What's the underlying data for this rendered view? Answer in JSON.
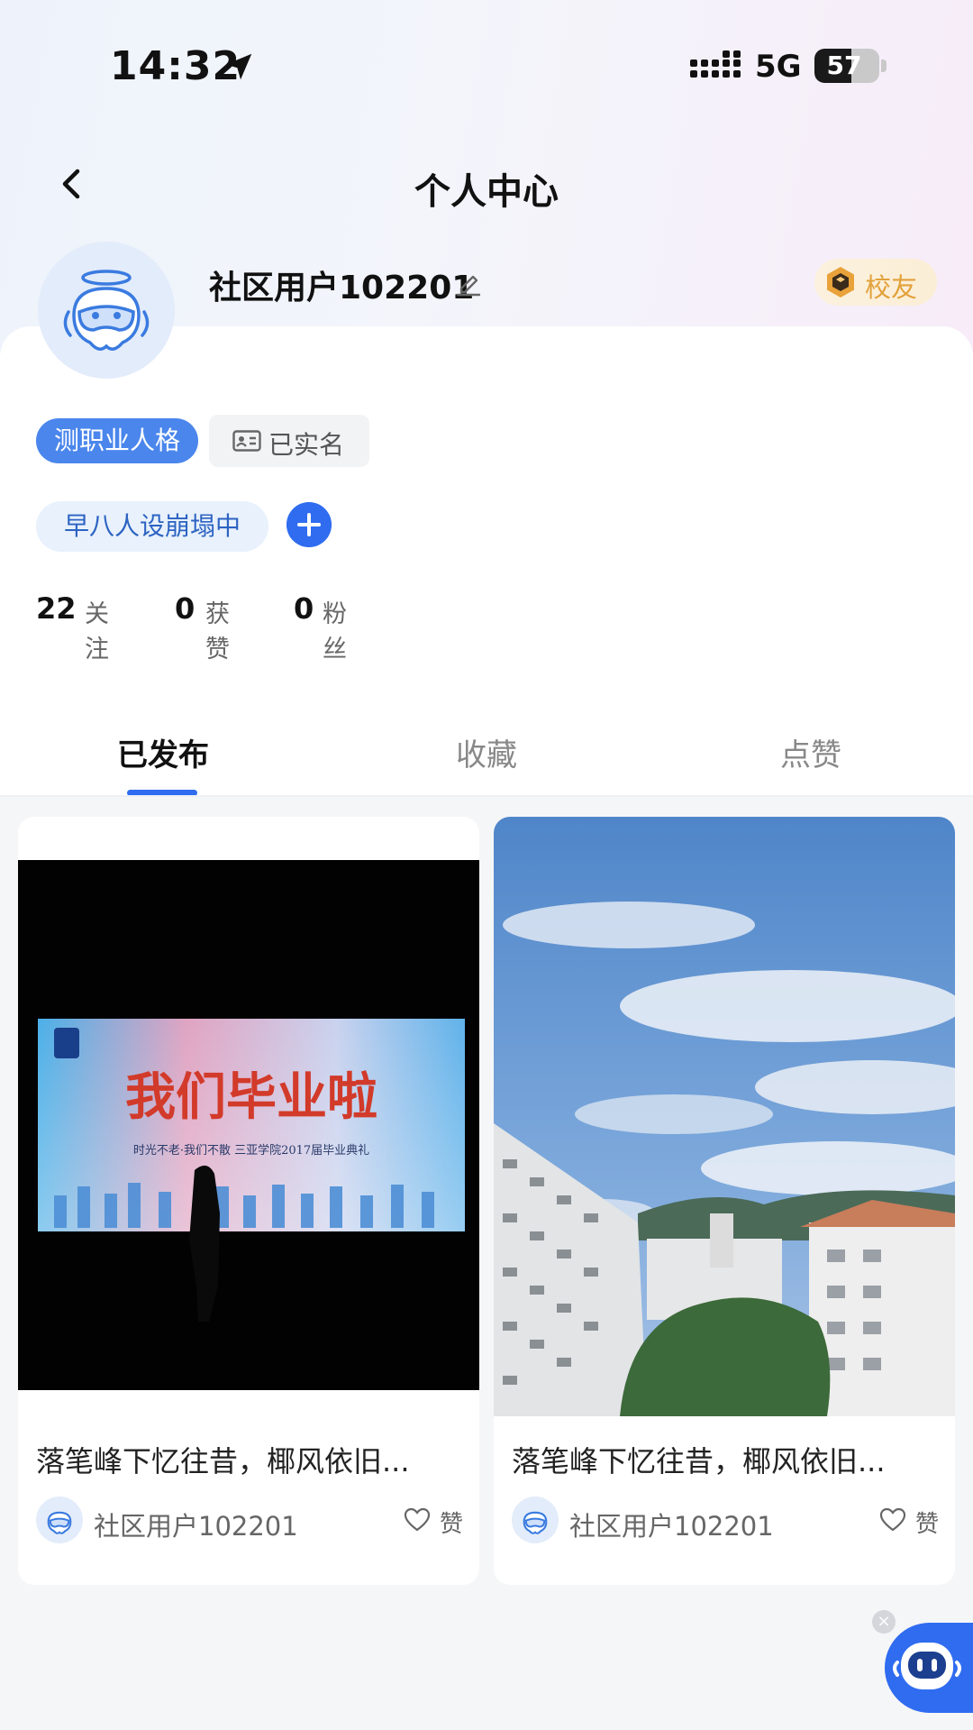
{
  "status_bar": {
    "time": "14:32",
    "network": "5G",
    "battery_level": "57",
    "battery_fraction": 0.57
  },
  "nav": {
    "back_icon": "chevron-left-icon",
    "title": "个人中心"
  },
  "profile": {
    "username": "社区用户102201",
    "edit_icon": "pencil-icon",
    "badge_label": "校友",
    "badge_icon": "alumni-hexagon-icon",
    "personality_tag": "测职业人格",
    "verified_label": "已实名",
    "status_tag": "早八人设崩塌中",
    "add_tag_icon": "plus-icon"
  },
  "stats": [
    {
      "count": "22",
      "label": "关注"
    },
    {
      "count": "0",
      "label": "获赞"
    },
    {
      "count": "0",
      "label": "粉丝"
    }
  ],
  "tabs": [
    {
      "label": "已发布",
      "active": true
    },
    {
      "label": "收藏",
      "active": false
    },
    {
      "label": "点赞",
      "active": false
    }
  ],
  "posts": [
    {
      "title": "落笔峰下忆往昔，椰风依旧...",
      "author": "社区用户102201",
      "like_label": "赞",
      "banner_text": "我们毕业啦",
      "banner_subtext": "时光不老·我们不散 三亚学院2017届毕业典礼"
    },
    {
      "title": "落笔峰下忆往昔，椰风依旧...",
      "author": "社区用户102201",
      "like_label": "赞"
    }
  ],
  "floating": {
    "close_label": "×",
    "assistant_icon": "robot-assistant-icon"
  },
  "colors": {
    "accent": "#2f6cf0",
    "badge_gold": "#e3a13a",
    "tag_blue": "#4a86ec"
  }
}
